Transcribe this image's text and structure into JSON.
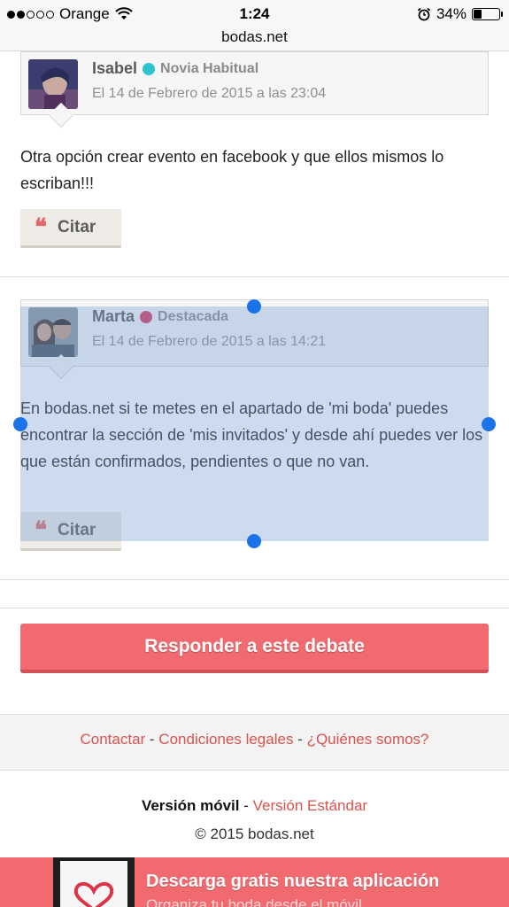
{
  "status_bar": {
    "carrier": "Orange",
    "time": "1:24",
    "battery": "34%",
    "battery_level": 0.34
  },
  "url_bar": {
    "domain": "bodas.net"
  },
  "posts": [
    {
      "author": "Isabel",
      "rank": "Novia Habitual",
      "rank_color": "#2ec4cf",
      "date": "El 14 de Febrero de 2015 a las 23:04",
      "text": "Otra opción crear evento en facebook y que ellos mismos lo escriban!!!",
      "quote_label": "Citar"
    },
    {
      "author": "Marta",
      "rank": "Destacada",
      "rank_color": "#d9365e",
      "date": "El 14 de Febrero de 2015 a las 14:21",
      "text": "En bodas.net si te metes en el apartado de 'mi boda' puedes encontrar la sección de 'mis invitados' y desde ahí puedes ver los que están confirmados, pendientes o que no van.",
      "quote_label": "Citar"
    }
  ],
  "reply_button": "Responder a este debate",
  "footer": {
    "links": [
      "Contactar",
      "Condiciones legales",
      "¿Quiénes somos?"
    ],
    "separator": " - ",
    "version_current": "Versión móvil",
    "version_separator": " - ",
    "version_other": "Versión Estándar",
    "copyright": "© 2015 bodas.net"
  },
  "app_banner": {
    "title": "Descarga gratis nuestra aplicación",
    "subtitle": "Organiza tu boda desde el móvil"
  },
  "colors": {
    "accent": "#f06a6f",
    "link": "#d9534f",
    "selection": "#78a0d2",
    "handle": "#1a73e8"
  }
}
